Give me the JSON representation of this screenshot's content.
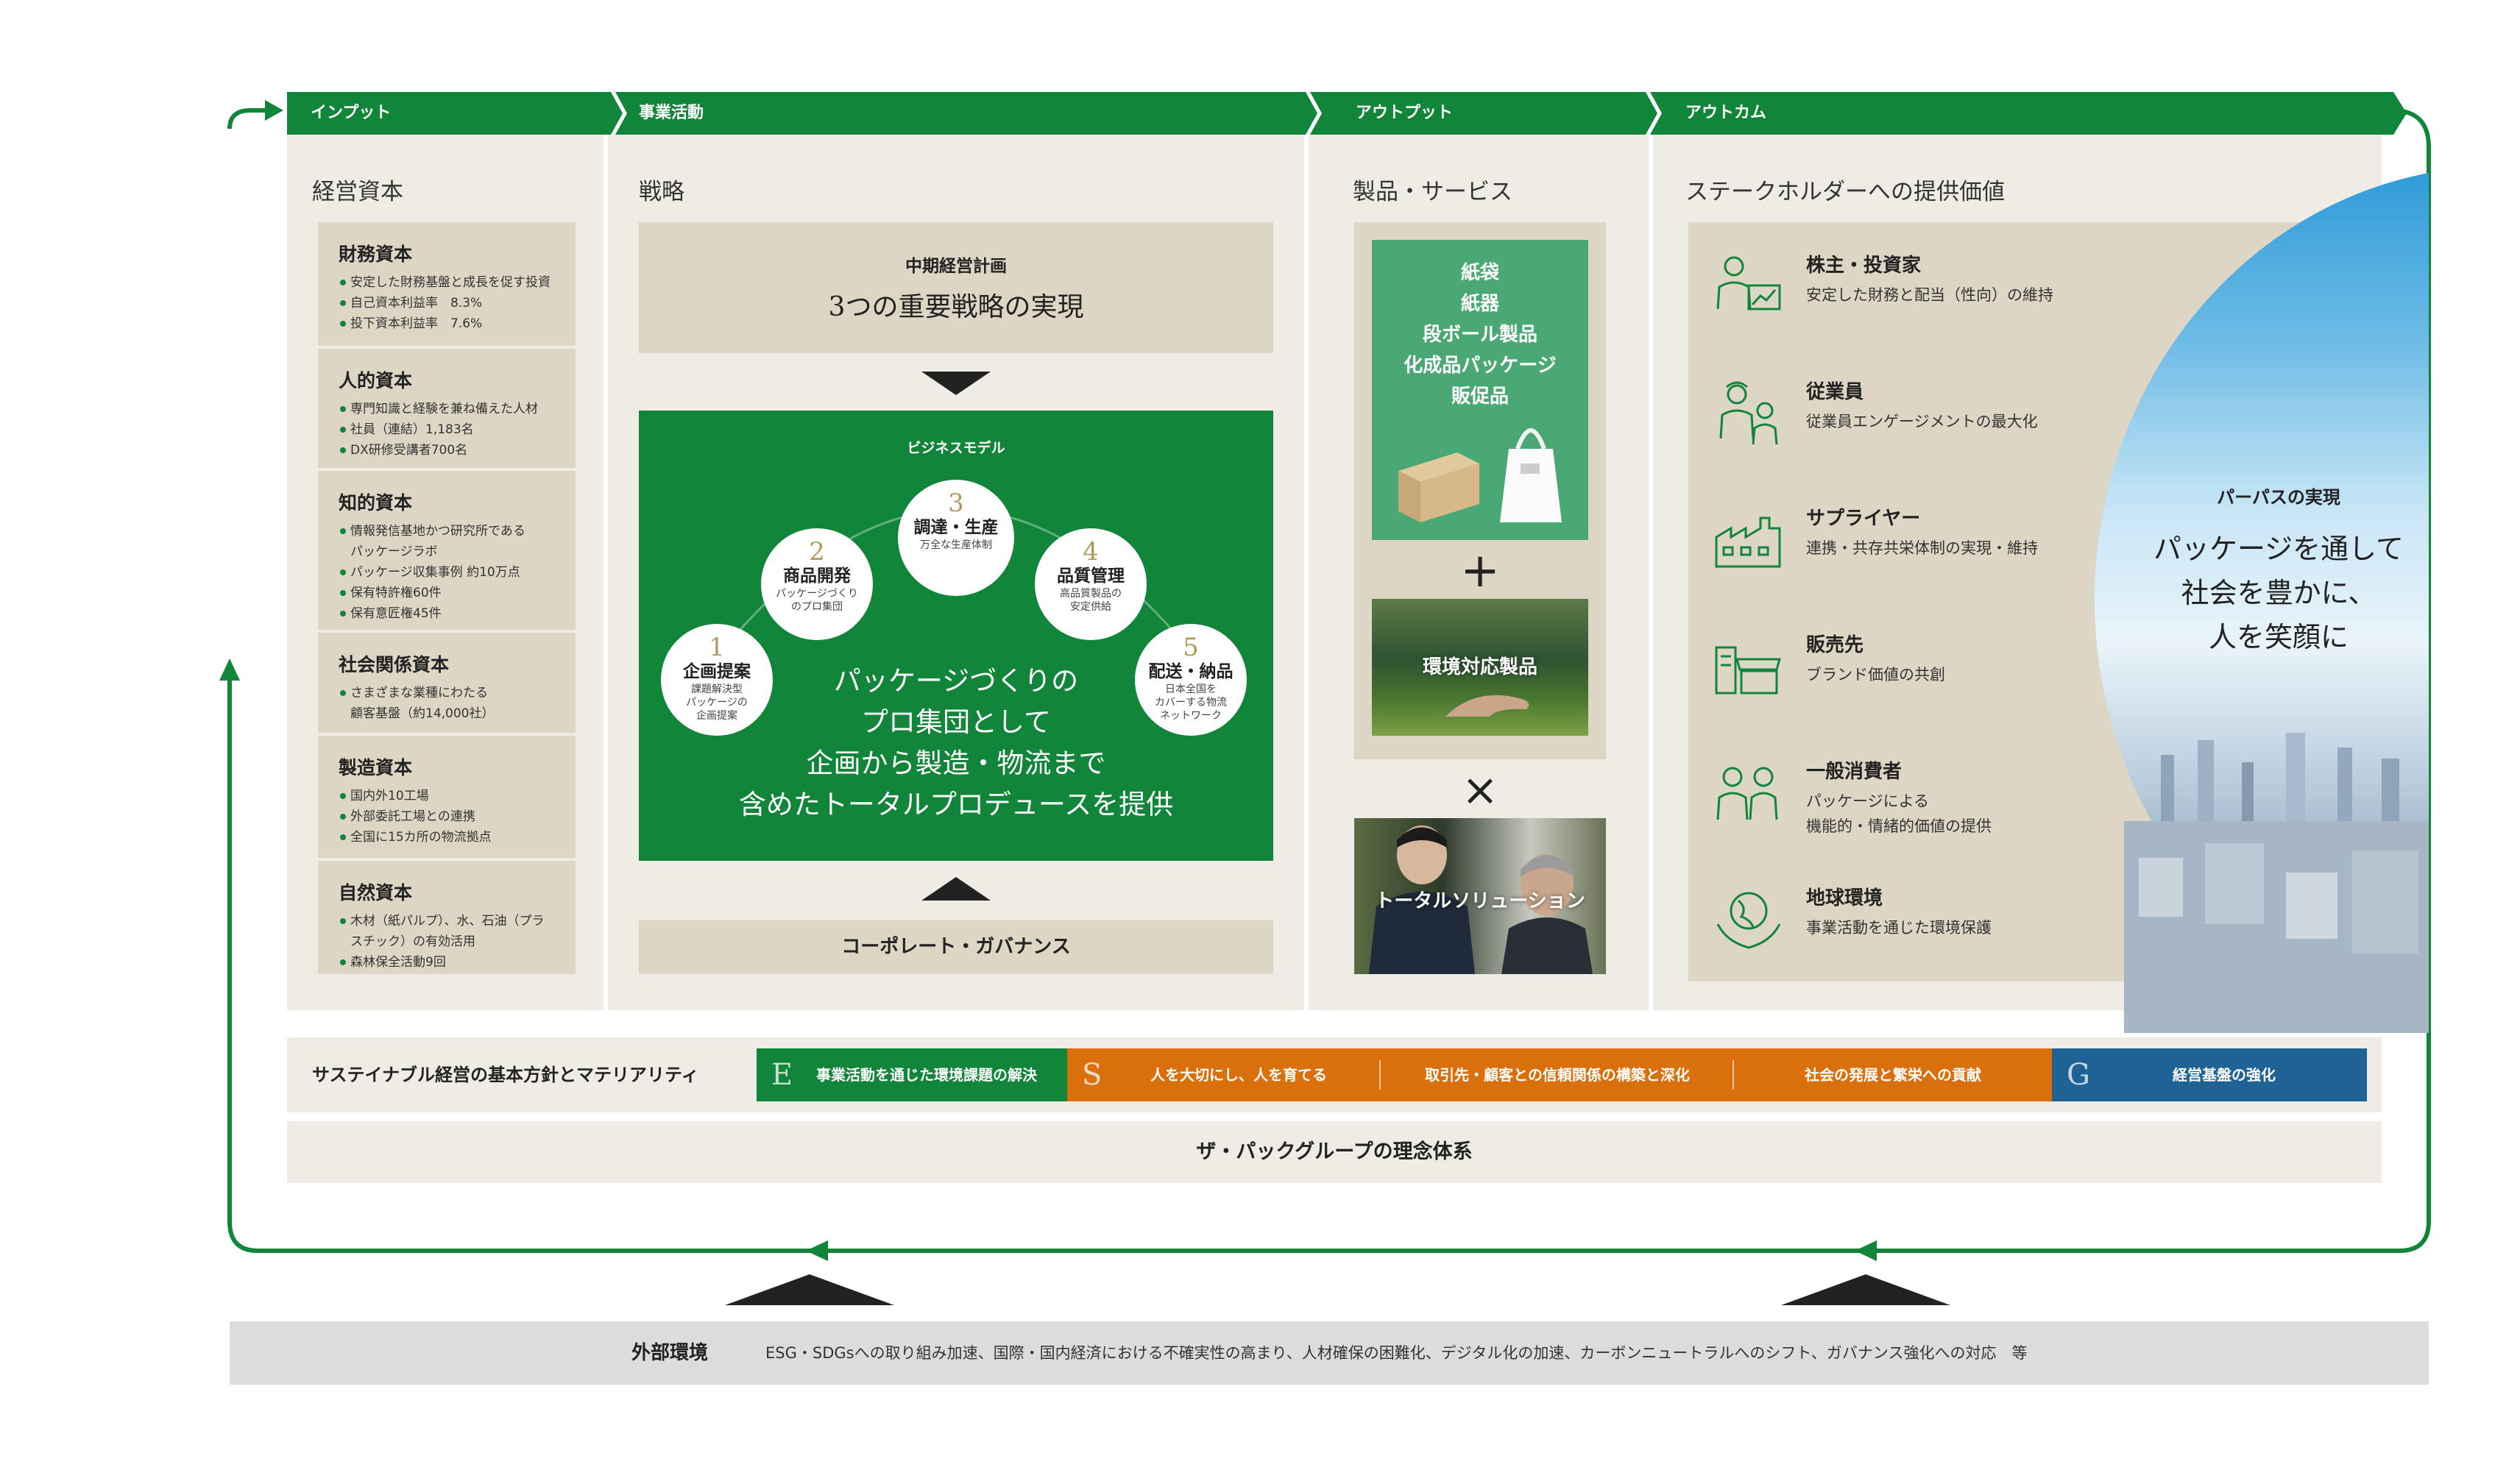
{
  "headers": {
    "input": "インプット",
    "business": "事業活動",
    "output": "アウトプット",
    "outcome": "アウトカム"
  },
  "input": {
    "title": "経営資本",
    "capitals": [
      {
        "name": "財務資本",
        "items": [
          "安定した財務基盤と成長を促す投資",
          "自己資本利益率　8.3%",
          "投下資本利益率　7.6%"
        ]
      },
      {
        "name": "人的資本",
        "items": [
          "専門知識と経験を兼ね備えた人材",
          "社員（連結）1,183名",
          "DX研修受講者700名"
        ]
      },
      {
        "name": "知的資本",
        "items": [
          "情報発信基地かつ研究所である",
          "パッケージラボ",
          "パッケージ収集事例 約10万点",
          "保有特許権60件",
          "保有意匠権45件"
        ]
      },
      {
        "name": "社会関係資本",
        "items": [
          "さまざまな業種にわたる",
          "顧客基盤（約14,000社）"
        ]
      },
      {
        "name": "製造資本",
        "items": [
          "国内外10工場",
          "外部委託工場との連携",
          "全国に15カ所の物流拠点"
        ]
      },
      {
        "name": "自然資本",
        "items": [
          "木材（紙パルプ）、水、石油（プラ",
          "スチック）の有効活用",
          "森林保全活動9回"
        ]
      }
    ]
  },
  "strategy": {
    "title": "戦略",
    "plan_label": "中期経営計画",
    "plan_title": "3つの重要戦略の実現",
    "model_label": "ビジネスモデル",
    "steps": [
      {
        "num": "1",
        "name": "企画提案",
        "desc": "課題解決型\nパッケージの\n企画提案"
      },
      {
        "num": "2",
        "name": "商品開発",
        "desc": "パッケージづくり\nのプロ集団"
      },
      {
        "num": "3",
        "name": "調達・生産",
        "desc": "万全な生産体制"
      },
      {
        "num": "4",
        "name": "品質管理",
        "desc": "高品質製品の\n安定供給"
      },
      {
        "num": "5",
        "name": "配送・納品",
        "desc": "日本全国を\nカバーする物流\nネットワーク"
      }
    ],
    "center_text": "パッケージづくりの\nプロ集団として\n企画から製造・物流まで\n含めたトータルプロデュースを提供",
    "governance": "コーポレート・ガバナンス"
  },
  "output": {
    "title": "製品・サービス",
    "products": [
      "紙袋",
      "紙器",
      "段ボール製品",
      "化成品パッケージ",
      "販促品"
    ],
    "plus": "+",
    "eco": "環境対応製品",
    "times": "×",
    "solution": "トータルソリューション"
  },
  "outcome": {
    "title": "ステークホルダーへの提供価値",
    "stakeholders": [
      {
        "name": "株主・投資家",
        "desc": "安定した財務と配当（性向）の維持",
        "icon": "investor-icon"
      },
      {
        "name": "従業員",
        "desc": "従業員エンゲージメントの最大化",
        "icon": "employee-icon"
      },
      {
        "name": "サプライヤー",
        "desc": "連携・共存共栄体制の実現・維持",
        "icon": "factory-icon"
      },
      {
        "name": "販売先",
        "desc": "ブランド価値の共創",
        "icon": "store-icon"
      },
      {
        "name": "一般消費者",
        "desc": "パッケージによる\n機能的・情緒的価値の提供",
        "icon": "consumer-icon"
      },
      {
        "name": "地球環境",
        "desc": "事業活動を通じた環境保護",
        "icon": "earth-icon"
      }
    ],
    "purpose_label": "パーパスの実現",
    "purpose_text": "パッケージを通して\n社会を豊かに、\n人を笑顔に"
  },
  "materiality": {
    "title": "サステイナブル経営の基本方針とマテリアリティ",
    "items": [
      {
        "letter": "E",
        "label": "事業活動を通じた環境課題の解決",
        "color": "#118539"
      },
      {
        "letter": "S",
        "label": "人を大切にし、人を育てる",
        "color": "#d9700c"
      },
      {
        "letter": "",
        "label": "取引先・顧客との信頼関係の構築と深化",
        "color": "#d9700c"
      },
      {
        "letter": "",
        "label": "社会の発展と繁栄への貢献",
        "color": "#d9700c"
      },
      {
        "letter": "G",
        "label": "経営基盤の強化",
        "color": "#1e6296"
      }
    ]
  },
  "philosophy": "ザ・パックグループの理念体系",
  "external": {
    "label": "外部環境",
    "text": "ESG・SDGsへの取り組み加速、国際・国内経済における不確実性の高まり、人材確保の困難化、デジタル化の加速、カーボンニュートラルへのシフト、ガバナンス強化への対応　等"
  },
  "colors": {
    "green": "#118539",
    "orange": "#d9700c",
    "blue": "#1e6296",
    "beige": "#efece5",
    "tan": "#ddd6c4"
  }
}
